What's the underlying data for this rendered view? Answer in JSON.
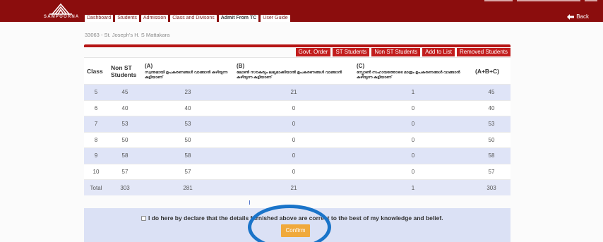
{
  "header": {
    "logo_text": "SAMPOORNA",
    "nav": [
      {
        "label": "Dashboard",
        "active": false
      },
      {
        "label": "Students",
        "active": false
      },
      {
        "label": "Admission",
        "active": false
      },
      {
        "label": "Class and Divisons",
        "active": false
      },
      {
        "label": "Admit From TC",
        "active": true
      },
      {
        "label": "User Guide",
        "active": false
      }
    ],
    "back_label": "Back"
  },
  "school": "33063 - St. Joseph's H. S Mattakara",
  "actions": [
    "Govt. Order",
    "ST Students",
    "Non ST Students",
    "Add to List",
    "Removed Students"
  ],
  "table": {
    "headers": {
      "class": "Class",
      "nonst": "Non ST Students",
      "a_prefix": "(A)",
      "a_text": "സ്വന്തമായി ഉപകരണങ്ങൾ വാങ്ങാൻ കഴിയുന്ന കുട്ടിയാണ്",
      "b_prefix": "(B)",
      "b_text": "ലോൺ സൗകര്യം ലഭ്യമാക്കിയാൽ ഉപകരണങ്ങൾ വാങ്ങാൻ കഴിയുന്ന കുട്ടിയാണ്",
      "c_prefix": "(C)",
      "c_text": "സ്പോൺ സഹായത്തോടെ മാത്രം ഉപകരണങ്ങൾ വാങ്ങാൻ കഴിയുന്ന കുട്ടിയാണ്",
      "sum": "(A+B+C)"
    },
    "rows": [
      [
        "5",
        "45",
        "23",
        "21",
        "1",
        "45"
      ],
      [
        "6",
        "40",
        "40",
        "0",
        "0",
        "40"
      ],
      [
        "7",
        "53",
        "53",
        "0",
        "0",
        "53"
      ],
      [
        "8",
        "50",
        "50",
        "0",
        "0",
        "50"
      ],
      [
        "9",
        "58",
        "58",
        "0",
        "0",
        "58"
      ],
      [
        "10",
        "57",
        "57",
        "0",
        "0",
        "57"
      ]
    ],
    "total": [
      "Total",
      "303",
      "281",
      "21",
      "1",
      "303"
    ]
  },
  "declaration": {
    "text": "I do here by declare that the details furnished above are correct to the best of my knowledge and belief.",
    "confirm_label": "Confirm"
  },
  "colors": {
    "header": "#8b0d0d",
    "accent": "#c21d1d",
    "stripe": "#dfe4f7",
    "confirm": "#f0a93c",
    "ring": "#1a74c9"
  }
}
